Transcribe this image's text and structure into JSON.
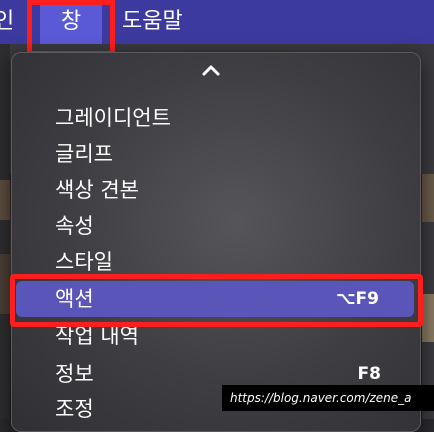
{
  "menubar": {
    "partial_label": "인",
    "window_label": "창",
    "help_label": "도움말"
  },
  "dropdown": {
    "scroll_up": "chevron-up",
    "items": [
      {
        "label": "그레이디언트",
        "shortcut": ""
      },
      {
        "label": "글리프",
        "shortcut": ""
      },
      {
        "label": "색상 견본",
        "shortcut": ""
      },
      {
        "label": "속성",
        "shortcut": ""
      },
      {
        "label": "스타일",
        "shortcut": ""
      },
      {
        "label": "액션",
        "shortcut": "⌥F9"
      },
      {
        "label": "작업 내역",
        "shortcut": ""
      },
      {
        "label": "정보",
        "shortcut": "F8"
      },
      {
        "label": "조정",
        "shortcut": ""
      }
    ],
    "selected_label": "액션"
  },
  "watermark": "https://blog.naver.com/zene_a",
  "colors": {
    "menubar_bg": "#3c3a9e",
    "selection": "#5a55b8",
    "highlight_box": "#ff1e1e"
  }
}
